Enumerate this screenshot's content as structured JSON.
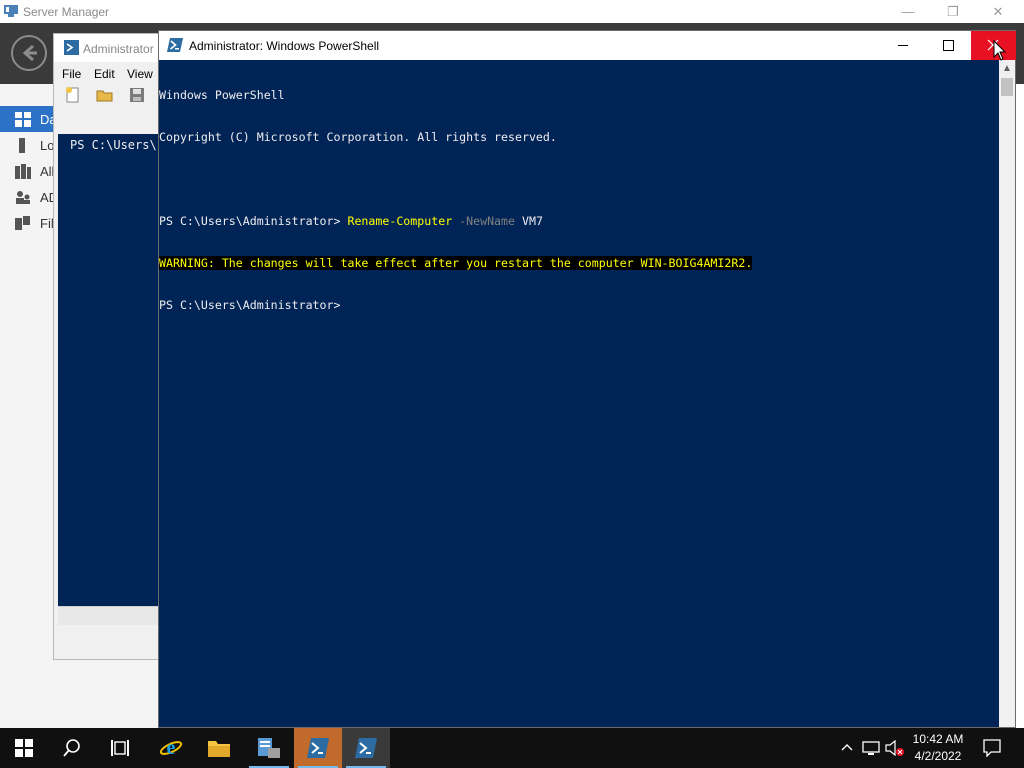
{
  "server_manager": {
    "title": "Server Manager",
    "nav_items": [
      {
        "label": "Da",
        "icon": "dashboard-icon",
        "active": true
      },
      {
        "label": "Lo",
        "icon": "local-server-icon",
        "active": false
      },
      {
        "label": "All",
        "icon": "all-servers-icon",
        "active": false
      },
      {
        "label": "AD",
        "icon": "ad-ds-icon",
        "active": false
      },
      {
        "label": "File",
        "icon": "file-services-icon",
        "active": false
      }
    ]
  },
  "background_ps_window": {
    "title": "Administrator",
    "menu": [
      "File",
      "Edit",
      "View"
    ],
    "toolbar_icons": [
      "new-file-icon",
      "open-folder-icon",
      "save-icon"
    ],
    "console_text": "PS C:\\Users\\"
  },
  "powershell": {
    "title": "Administrator: Windows PowerShell",
    "lines": {
      "banner1": "Windows PowerShell",
      "banner2": "Copyright (C) Microsoft Corporation. All rights reserved.",
      "blank": "",
      "prompt1": "PS C:\\Users\\Administrator> ",
      "cmd_name": "Rename-Computer",
      "cmd_param": " -NewName",
      "cmd_value": " VM7",
      "warning": "WARNING: The changes will take effect after you restart the computer WIN-BOIG4AMI2R2.",
      "prompt2": "PS C:\\Users\\Administrator>"
    }
  },
  "taskbar": {
    "apps": [
      "start-icon",
      "search-icon",
      "task-view-icon",
      "internet-explorer-icon",
      "file-explorer-icon",
      "server-manager-icon",
      "powershell-icon",
      "powershell-icon"
    ],
    "time": "10:42 AM",
    "date": "4/2/2022"
  },
  "colors": {
    "console_bg": "#012456",
    "console_fg": "#eeedf0",
    "warning_fg": "#ffff00",
    "close_button": "#e81123",
    "active_nav": "#2c72c7"
  }
}
